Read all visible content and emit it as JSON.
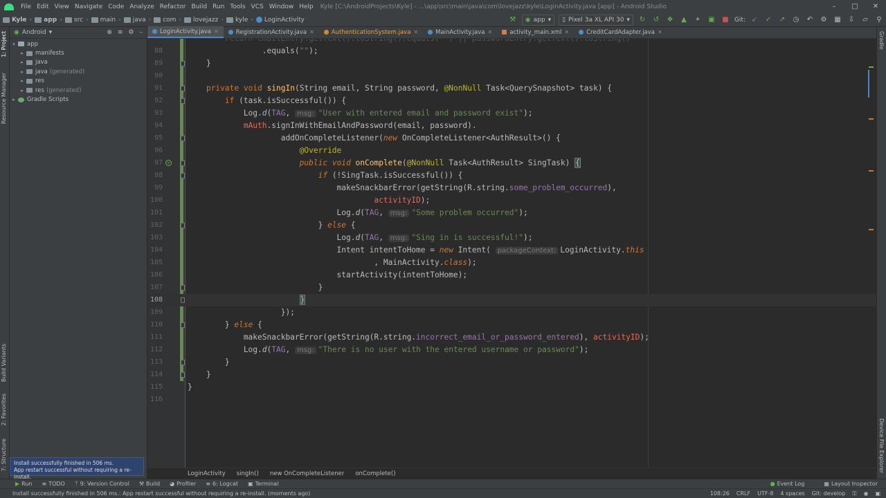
{
  "menubar": {
    "items": [
      "File",
      "Edit",
      "View",
      "Navigate",
      "Code",
      "Analyze",
      "Refactor",
      "Build",
      "Run",
      "Tools",
      "VCS",
      "Window",
      "Help"
    ],
    "title": "Kyle [C:\\AndroidProjects\\Kyle] - ...\\app\\src\\main\\java\\com\\lovejazz\\kyle\\LoginActivity.java [app] - Android Studio"
  },
  "navbar": {
    "crumbs": [
      "Kyle",
      "app",
      "src",
      "main",
      "java",
      "com",
      "lovejazz",
      "kyle",
      "LoginActivity"
    ],
    "run_config": "app",
    "device": "Pixel 3a XL API 30",
    "git_label": "Git:"
  },
  "project": {
    "view_label": "Android",
    "tree": [
      {
        "label": "app",
        "extra": "",
        "level": 0
      },
      {
        "label": "manifests",
        "extra": "",
        "level": 1
      },
      {
        "label": "java",
        "extra": "",
        "level": 1
      },
      {
        "label": "java",
        "extra": "(generated)",
        "level": 1
      },
      {
        "label": "res",
        "extra": "",
        "level": 1
      },
      {
        "label": "res",
        "extra": "(generated)",
        "level": 1
      },
      {
        "label": "Gradle Scripts",
        "extra": "",
        "level": 0
      }
    ]
  },
  "left_tabs": {
    "project": "1: Project",
    "resource_manager": "Resource Manager",
    "build_variants": "Build Variants",
    "favorites": "2: Favorites",
    "structure": "7: Structure"
  },
  "right_tabs": {
    "gradle": "Gradle",
    "device_explorer": "Device File Explorer"
  },
  "tabs": [
    {
      "label": "LoginActivity.java",
      "active": true
    },
    {
      "label": "RegistrationActivity.java",
      "active": false
    },
    {
      "label": "AuthenticationSystem.java",
      "active": false
    },
    {
      "label": "MainActivity.java",
      "active": false
    },
    {
      "label": "activity_main.xml",
      "active": false
    },
    {
      "label": "CreditCardAdapter.java",
      "active": false
    }
  ],
  "editor": {
    "line_numbers": [
      "88",
      "89",
      "90",
      "91",
      "92",
      "93",
      "94",
      "95",
      "96",
      "97",
      "98",
      "99",
      "100",
      "101",
      "102",
      "103",
      "104",
      "105",
      "106",
      "107",
      "108",
      "109",
      "110",
      "111",
      "112",
      "113",
      "114",
      "115",
      "116"
    ],
    "current_line": "108"
  },
  "breadcrumbs": [
    "LoginActivity",
    "singIn()",
    "new OnCompleteListener",
    "onComplete()"
  ],
  "tool_windows": {
    "left": [
      "Run",
      "TODO",
      "9: Version Control",
      "Build",
      "Profiler",
      "6: Logcat",
      "Terminal"
    ],
    "right": [
      "Event Log",
      "Layout Inspector"
    ]
  },
  "status": {
    "message": "Install successfully finished in 506 ms.: App restart successful without requiring a re-install. (moments ago)",
    "position": "108:26",
    "line_sep": "CRLF",
    "encoding": "UTF-8",
    "indent": "4 spaces",
    "branch": "Git: develop"
  },
  "notification": {
    "line1": "Install successfully finished in 506 ms.",
    "line2": "App restart successful without requiring a re-install."
  },
  "colors": {
    "background": "#2b2b2b",
    "panel": "#3c3f41",
    "keyword": "#cc7832",
    "method": "#ffc66d",
    "string": "#6a8759",
    "annotation": "#bbb529",
    "field": "#9876aa",
    "accent": "#4a88c7"
  }
}
